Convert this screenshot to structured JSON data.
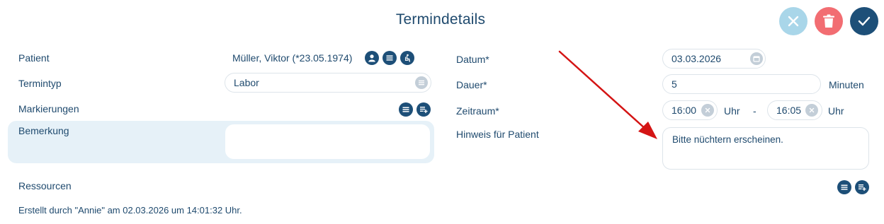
{
  "header": {
    "title": "Termindetails"
  },
  "actions": {
    "cancel_icon": "close-icon",
    "delete_icon": "trash-icon",
    "confirm_icon": "check-icon"
  },
  "left": {
    "patient_label": "Patient",
    "patient_value": "Müller, Viktor (*23.05.1974)",
    "termintyp_label": "Termintyp",
    "termintyp_value": "Labor",
    "markierungen_label": "Markierungen",
    "bemerkung_label": "Bemerkung",
    "bemerkung_value": "",
    "ressourcen_label": "Ressourcen"
  },
  "right": {
    "datum_label": "Datum*",
    "datum_value": "03.03.2026",
    "dauer_label": "Dauer*",
    "dauer_value": "5",
    "dauer_unit": "Minuten",
    "zeitraum_label": "Zeitraum*",
    "zeit_von": "16:00",
    "zeit_von_unit": "Uhr",
    "zeit_separator": "-",
    "zeit_bis": "16:05",
    "zeit_bis_unit": "Uhr",
    "hinweis_label": "Hinweis für Patient",
    "hinweis_value": "Bitte nüchtern erscheinen."
  },
  "footer": {
    "created": "Erstellt durch \"Annie\" am 02.03.2026 um 14:01:32 Uhr."
  },
  "colors": {
    "primary": "#1d4f78",
    "cancel": "#a9d6e9",
    "delete": "#f26d72",
    "arrow": "#d41414"
  }
}
